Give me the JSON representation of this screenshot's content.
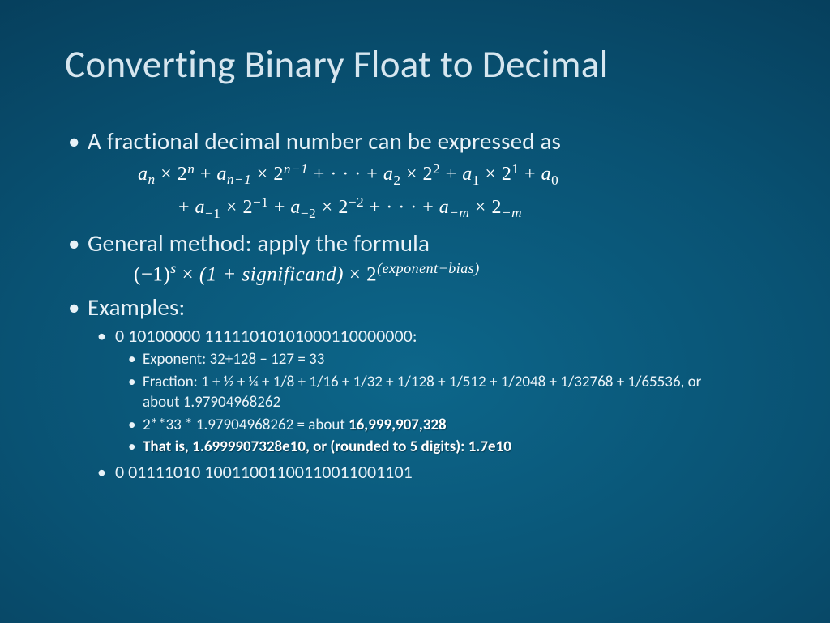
{
  "title": "Converting Binary Float to Decimal",
  "b1": {
    "label": "A  fractional decimal number can be expressed as"
  },
  "math": {
    "a": "a",
    "x": " × ",
    "two": "2",
    "plus": " + ",
    "dots": "· · ·",
    "n": "n",
    "nm1": "n−1",
    "t2": "2",
    "t1": "1",
    "t0": "0",
    "m1": "−1",
    "m2": "−2",
    "mm": "−m",
    "neg1": "(−1)",
    "s": "s",
    "sig": "(1 +  significand)",
    "exp": "(exponent−bias)"
  },
  "b2": {
    "label": "General method: apply the formula"
  },
  "b3": {
    "label": "Examples:"
  },
  "ex1": {
    "bits": "0 10100000 11111010101000110000000:",
    "exp": "Exponent: 32+128 – 127 = 33",
    "frac": "Fraction: 1 + ½ + ¼ + 1/8 + 1/16 + 1/32 + 1/128 + 1/512 + 1/2048 + 1/32768 + 1/65536, or about 1.97904968262",
    "mul_a": "2**33 * 1.97904968262 = about ",
    "mul_b": "16,999,907,328",
    "that": "That is, 1.6999907328e10, or (rounded to 5 digits): 1.7e10"
  },
  "ex2": {
    "bits": "0 01111010 10011001100110011001101"
  }
}
